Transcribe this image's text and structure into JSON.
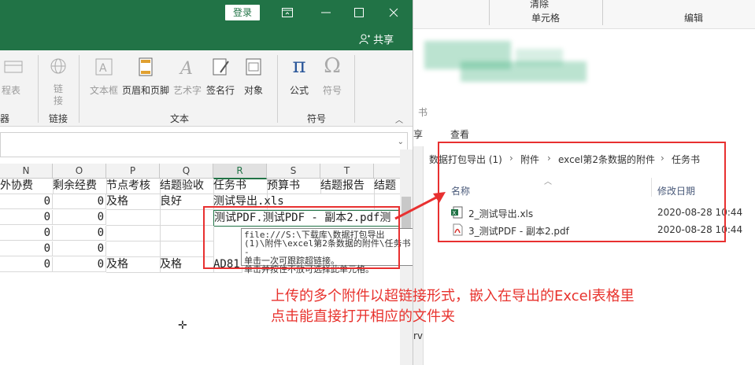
{
  "excel": {
    "login": "登录",
    "share": "共享",
    "ribbon": {
      "items": [
        {
          "label": "日程表"
        },
        {
          "label": "链接"
        },
        {
          "label": "文本框"
        },
        {
          "label": "页眉和页脚"
        },
        {
          "label": "艺术字"
        },
        {
          "label": "签名行"
        },
        {
          "label": "对象"
        },
        {
          "label": "公式"
        },
        {
          "label": "符号"
        }
      ],
      "groups": {
        "left": "器",
        "link": "链接",
        "text": "文本",
        "symbol": "符号"
      }
    },
    "columns": [
      "N",
      "O",
      "P",
      "Q",
      "R",
      "S",
      "T"
    ],
    "headers": [
      "外协费",
      "剩余经费",
      "节点考核",
      "结题验收",
      "任务书",
      "预算书",
      "结题报告",
      "结题"
    ],
    "rows": [
      [
        "0",
        "0",
        "及格",
        "良好",
        "测试导出.xls",
        "",
        "",
        ""
      ],
      [
        "0",
        "0",
        "",
        "",
        "测试PDF.测试PDF - 副本2.pdf测",
        "",
        "",
        ""
      ],
      [
        "0",
        "0",
        "",
        "",
        "",
        "",
        "",
        ""
      ],
      [
        "0",
        "0",
        "",
        "",
        "",
        "",
        "",
        ""
      ],
      [
        "0",
        "0",
        "及格",
        "及格",
        "AD81",
        "",
        "",
        ""
      ]
    ],
    "tooltip": {
      "line1": "file:///S:\\下载库\\数据打包导出",
      "line2": "(1)\\附件\\excel第2条数据的附件\\任务书 -",
      "line3": "单击一次可跟踪超链接。",
      "line4": "单击并按住不放可选择此单元格。"
    }
  },
  "explorer": {
    "top_groups": [
      "单元格",
      "编辑"
    ],
    "clear": "清除",
    "tabs": [
      "享",
      "查看"
    ],
    "tab_partial": "书",
    "breadcrumb": [
      "«",
      "数据打包导出 (1)",
      "附件",
      "excel第2条数据的附件",
      "任务书"
    ],
    "columns": {
      "name": "名称",
      "modified": "修改日期"
    },
    "files": [
      {
        "name": "2_测试导出.xls",
        "date": "2020-08-28 10:44",
        "icon": "excel-file-icon"
      },
      {
        "name": "3_测试PDF - 副本2.pdf",
        "date": "2020-08-28 10:44",
        "icon": "pdf-file-icon"
      }
    ],
    "partial_side": "rv"
  },
  "annotation": {
    "line1": "上传的多个附件以超链接形式，嵌入在导出的Excel表格里",
    "line2": "点击能直接打开相应的文件夹"
  },
  "colors": {
    "excel_green": "#217346",
    "annotation_red": "#e83030"
  }
}
